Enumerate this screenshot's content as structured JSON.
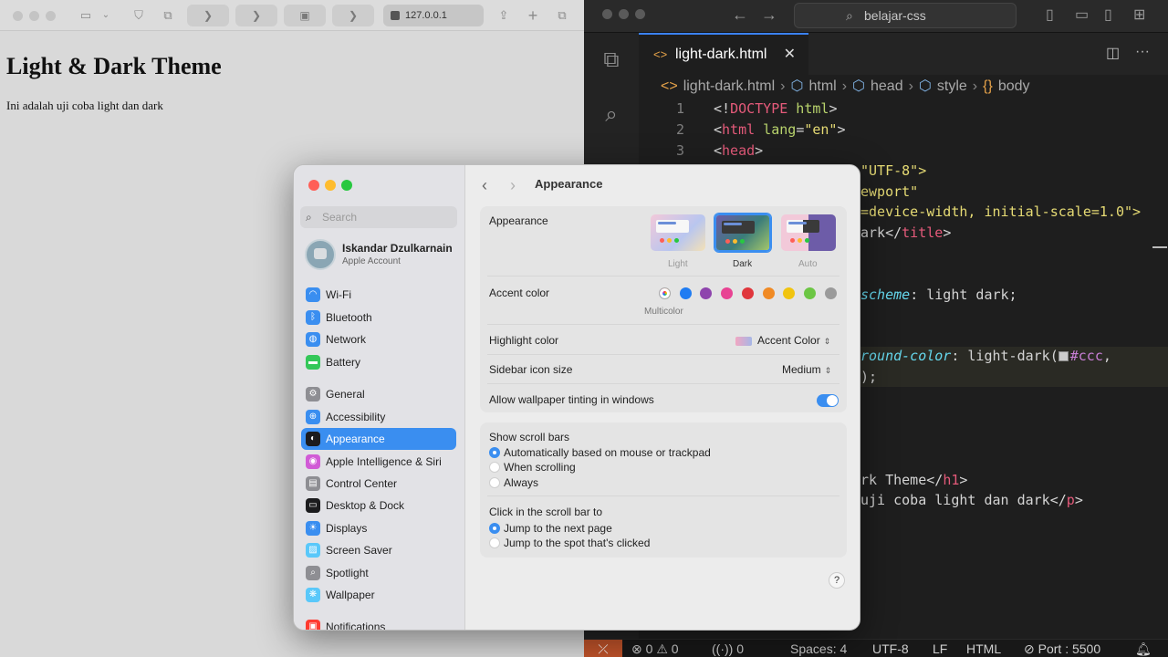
{
  "safari": {
    "url": "127.0.0.1",
    "page_title": "Light & Dark Theme",
    "page_text": "Ini adalah uji coba light dan dark"
  },
  "vscode": {
    "search": "belajar-css",
    "tab_label": "light-dark.html",
    "breadcrumb": [
      "light-dark.html",
      "html",
      "head",
      "style",
      "body"
    ],
    "code": {
      "l1_num": "1",
      "l1": [
        "<!",
        "DOCTYPE",
        " html",
        ">"
      ],
      "l2_num": "2",
      "l2": [
        "<",
        "html",
        " lang",
        "=",
        "\"en\"",
        ">"
      ],
      "l3_num": "3",
      "l3": [
        "<",
        "head",
        ">"
      ],
      "f_utf": "\"UTF-8\">",
      "f_viewport": "ewport\"",
      "f_content": "=device-width, initial-scale=1.0\">",
      "f_title": [
        "ark</",
        "title",
        ">"
      ],
      "f_scheme": [
        "scheme",
        ": light dark;"
      ],
      "f_bg": [
        "round-color",
        ": light-dark(",
        "#ccc",
        ","
      ],
      "f_close": ");",
      "f_h1": [
        "rk Theme</",
        "h1",
        ">"
      ],
      "f_p": [
        "uji coba light dan dark</",
        "p",
        ">"
      ]
    },
    "status": {
      "errors": "0",
      "warnings": "0",
      "ports": "0",
      "spaces": "Spaces: 4",
      "encoding": "UTF-8",
      "eol": "LF",
      "language": "HTML",
      "port": "Port : 5500"
    }
  },
  "settings": {
    "search_placeholder": "Search",
    "account_name": "Iskandar Dzulkarnain",
    "account_sub": "Apple Account",
    "sidebar": [
      {
        "label": "Wi-Fi",
        "icon": "wifi-icon",
        "color": "#3a8ef0"
      },
      {
        "label": "Bluetooth",
        "icon": "bluetooth-icon",
        "color": "#3a8ef0"
      },
      {
        "label": "Network",
        "icon": "globe-icon",
        "color": "#3a8ef0"
      },
      {
        "label": "Battery",
        "icon": "battery-icon",
        "color": "#34c759"
      },
      {
        "label": "General",
        "icon": "gear-icon",
        "color": "#8e8e93"
      },
      {
        "label": "Accessibility",
        "icon": "accessibility-icon",
        "color": "#3a8ef0"
      },
      {
        "label": "Appearance",
        "icon": "appearance-icon",
        "color": "#1c1c1e"
      },
      {
        "label": "Apple Intelligence & Siri",
        "icon": "siri-icon",
        "color": "#d15bd6"
      },
      {
        "label": "Control Center",
        "icon": "control-center-icon",
        "color": "#8e8e93"
      },
      {
        "label": "Desktop & Dock",
        "icon": "dock-icon",
        "color": "#1c1c1e"
      },
      {
        "label": "Displays",
        "icon": "displays-icon",
        "color": "#3a8ef0"
      },
      {
        "label": "Screen Saver",
        "icon": "screen-saver-icon",
        "color": "#5ac8fa"
      },
      {
        "label": "Spotlight",
        "icon": "spotlight-icon",
        "color": "#8e8e93"
      },
      {
        "label": "Wallpaper",
        "icon": "wallpaper-icon",
        "color": "#5ac8fa"
      },
      {
        "label": "Notifications",
        "icon": "notifications-icon",
        "color": "#ff3b30"
      }
    ],
    "title": "Appearance",
    "appearance_label": "Appearance",
    "themes": [
      "Light",
      "Dark",
      "Auto"
    ],
    "selected_theme": "Dark",
    "accent_label": "Accent color",
    "accent_colors": [
      "#c44bd6",
      "#1f7cf2",
      "#8e44ad",
      "#e84393",
      "#e0363c",
      "#f08a24",
      "#f1c40f",
      "#6cc644",
      "#9a9a9a"
    ],
    "accent_sub": "Multicolor",
    "highlight_label": "Highlight color",
    "highlight_value": "Accent Color",
    "icon_size_label": "Sidebar icon size",
    "icon_size_value": "Medium",
    "tinting_label": "Allow wallpaper tinting in windows",
    "tinting_on": true,
    "scroll_label": "Show scroll bars",
    "scroll_options": [
      "Automatically based on mouse or trackpad",
      "When scrolling",
      "Always"
    ],
    "click_label": "Click in the scroll bar to",
    "click_options": [
      "Jump to the next page",
      "Jump to the spot that's clicked"
    ],
    "help": "?"
  }
}
